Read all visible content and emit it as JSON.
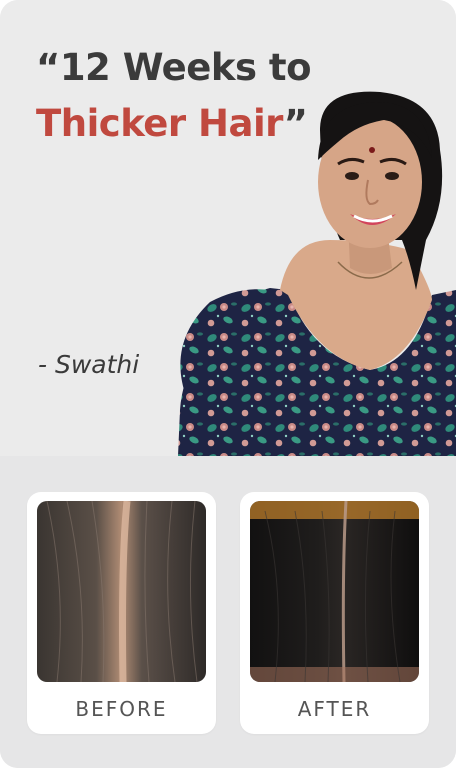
{
  "testimonial": {
    "headline_line1": "“12 Weeks to",
    "headline_accent": "Thicker Hair",
    "headline_close": "”",
    "author": "- Swathi"
  },
  "comparison": {
    "before_label": "BEFORE",
    "after_label": "AFTER"
  },
  "colors": {
    "accent": "#c0493f",
    "text": "#3b3b3b",
    "card_bg": "#e6e6e7"
  }
}
